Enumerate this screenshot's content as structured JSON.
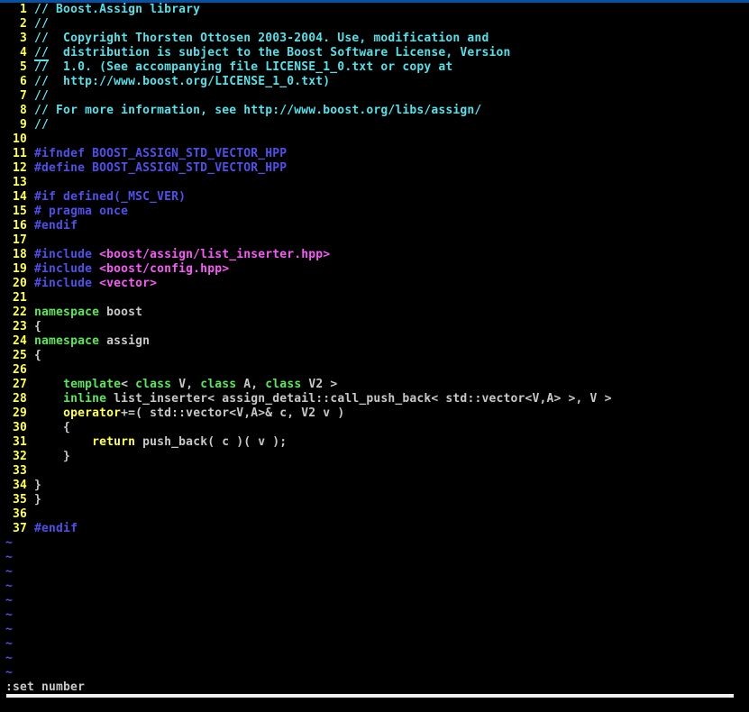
{
  "colors": {
    "background": "#000000",
    "stripe": "#0551a4",
    "number": "#ffff55",
    "comment": "#58dfe8",
    "preproc": "#5050e8",
    "string": "#f55cf5",
    "type": "#5ce65c",
    "stmt": "#ffff55",
    "text": "#c8c8c8",
    "tilde": "#5050e8",
    "bar": "#f0f0f0"
  },
  "editor": {
    "lines": [
      {
        "num": 1,
        "segments": [
          {
            "c": "comment",
            "t": "// Boost.Assign library"
          }
        ]
      },
      {
        "num": 2,
        "segments": [
          {
            "c": "comment",
            "t": "//"
          }
        ]
      },
      {
        "num": 3,
        "segments": [
          {
            "c": "comment",
            "t": "//  Copyright Thorsten Ottosen 2003-2004. Use, modification and"
          }
        ]
      },
      {
        "num": 4,
        "segments": [
          {
            "c": "comment",
            "t": "//",
            "cursor": true
          },
          {
            "c": "comment",
            "t": "  distribution is subject to the Boost Software License, Version"
          }
        ]
      },
      {
        "num": 5,
        "segments": [
          {
            "c": "comment",
            "t": "//  1.0. (See accompanying file LICENSE_1_0.txt or copy at"
          }
        ]
      },
      {
        "num": 6,
        "segments": [
          {
            "c": "comment",
            "t": "//  http://www.boost.org/LICENSE_1_0.txt)"
          }
        ]
      },
      {
        "num": 7,
        "segments": [
          {
            "c": "comment",
            "t": "//"
          }
        ]
      },
      {
        "num": 8,
        "segments": [
          {
            "c": "comment",
            "t": "// For more information, see http://www.boost.org/libs/assign/"
          }
        ]
      },
      {
        "num": 9,
        "segments": [
          {
            "c": "comment",
            "t": "//"
          }
        ]
      },
      {
        "num": 10,
        "segments": []
      },
      {
        "num": 11,
        "segments": [
          {
            "c": "preproc",
            "t": "#ifndef BOOST_ASSIGN_STD_VECTOR_HPP"
          }
        ]
      },
      {
        "num": 12,
        "segments": [
          {
            "c": "preproc",
            "t": "#define BOOST_ASSIGN_STD_VECTOR_HPP"
          }
        ]
      },
      {
        "num": 13,
        "segments": []
      },
      {
        "num": 14,
        "segments": [
          {
            "c": "preproc",
            "t": "#if defined(_MSC_VER)"
          }
        ]
      },
      {
        "num": 15,
        "segments": [
          {
            "c": "preproc",
            "t": "# pragma once"
          }
        ]
      },
      {
        "num": 16,
        "segments": [
          {
            "c": "preproc",
            "t": "#endif"
          }
        ]
      },
      {
        "num": 17,
        "segments": []
      },
      {
        "num": 18,
        "segments": [
          {
            "c": "preproc",
            "t": "#include "
          },
          {
            "c": "string",
            "t": "<boost/assign/list_inserter.hpp>"
          }
        ]
      },
      {
        "num": 19,
        "segments": [
          {
            "c": "preproc",
            "t": "#include "
          },
          {
            "c": "string",
            "t": "<boost/config.hpp>"
          }
        ]
      },
      {
        "num": 20,
        "segments": [
          {
            "c": "preproc",
            "t": "#include "
          },
          {
            "c": "string",
            "t": "<vector>"
          }
        ]
      },
      {
        "num": 21,
        "segments": []
      },
      {
        "num": 22,
        "segments": [
          {
            "c": "type",
            "t": "namespace"
          },
          {
            "c": "text",
            "t": " boost"
          }
        ]
      },
      {
        "num": 23,
        "segments": [
          {
            "c": "text",
            "t": "{"
          }
        ]
      },
      {
        "num": 24,
        "segments": [
          {
            "c": "type",
            "t": "namespace"
          },
          {
            "c": "text",
            "t": " assign"
          }
        ]
      },
      {
        "num": 25,
        "segments": [
          {
            "c": "text",
            "t": "{"
          }
        ]
      },
      {
        "num": 26,
        "segments": []
      },
      {
        "num": 27,
        "segments": [
          {
            "c": "text",
            "t": "    "
          },
          {
            "c": "type",
            "t": "template"
          },
          {
            "c": "text",
            "t": "< "
          },
          {
            "c": "type",
            "t": "class"
          },
          {
            "c": "text",
            "t": " V, "
          },
          {
            "c": "type",
            "t": "class"
          },
          {
            "c": "text",
            "t": " A, "
          },
          {
            "c": "type",
            "t": "class"
          },
          {
            "c": "text",
            "t": " V2 >"
          }
        ]
      },
      {
        "num": 28,
        "segments": [
          {
            "c": "text",
            "t": "    "
          },
          {
            "c": "type",
            "t": "inline"
          },
          {
            "c": "text",
            "t": " list_inserter< assign_detail::call_push_back< std::vector<V,A> >, V >"
          }
        ]
      },
      {
        "num": 29,
        "segments": [
          {
            "c": "text",
            "t": "    "
          },
          {
            "c": "stmt",
            "t": "operator"
          },
          {
            "c": "text",
            "t": "+=( std::vector<V,A>& c, V2 v )"
          }
        ]
      },
      {
        "num": 30,
        "segments": [
          {
            "c": "text",
            "t": "    {"
          }
        ]
      },
      {
        "num": 31,
        "segments": [
          {
            "c": "text",
            "t": "        "
          },
          {
            "c": "stmt",
            "t": "return"
          },
          {
            "c": "text",
            "t": " push_back( c )( v );"
          }
        ]
      },
      {
        "num": 32,
        "segments": [
          {
            "c": "text",
            "t": "    }"
          }
        ]
      },
      {
        "num": 33,
        "segments": []
      },
      {
        "num": 34,
        "segments": [
          {
            "c": "text",
            "t": "}"
          }
        ]
      },
      {
        "num": 35,
        "segments": [
          {
            "c": "text",
            "t": "}"
          }
        ]
      },
      {
        "num": 36,
        "segments": []
      },
      {
        "num": 37,
        "segments": [
          {
            "c": "preproc",
            "t": "#endif"
          }
        ]
      }
    ],
    "tilde": "~",
    "tilde_rows": 10,
    "command_line": ":set number"
  }
}
